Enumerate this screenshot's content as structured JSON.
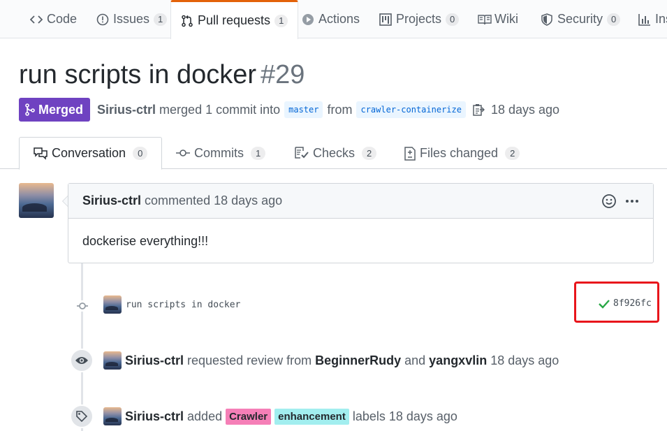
{
  "repo_nav": {
    "tabs": [
      {
        "label": "Code",
        "count": "",
        "icon": "code-icon"
      },
      {
        "label": "Issues",
        "count": "1",
        "icon": "issue-icon"
      },
      {
        "label": "Pull requests",
        "count": "1",
        "icon": "pull-request-icon",
        "selected": true
      },
      {
        "label": "Actions",
        "count": "",
        "icon": "play-icon"
      },
      {
        "label": "Projects",
        "count": "0",
        "icon": "project-icon"
      },
      {
        "label": "Wiki",
        "count": "",
        "icon": "book-icon"
      },
      {
        "label": "Security",
        "count": "0",
        "icon": "shield-icon"
      },
      {
        "label": "Ins",
        "count": "",
        "icon": "graph-icon"
      }
    ]
  },
  "pr": {
    "title": "run scripts in docker",
    "number": "#29",
    "state": "Merged",
    "author": "Sirius-ctrl",
    "action_text": "merged 1 commit into",
    "base_branch": "master",
    "from_text": "from",
    "head_branch": "crawler-containerize",
    "time": "18 days ago"
  },
  "pr_tabs": [
    {
      "label": "Conversation",
      "count": "0",
      "icon": "comment-icon"
    },
    {
      "label": "Commits",
      "count": "1",
      "icon": "commit-icon"
    },
    {
      "label": "Checks",
      "count": "2",
      "icon": "checklist-icon"
    },
    {
      "label": "Files changed",
      "count": "2",
      "icon": "file-diff-icon"
    }
  ],
  "comment": {
    "author": "Sirius-ctrl",
    "meta": "commented 18 days ago",
    "body": "dockerise everything!!!"
  },
  "commit": {
    "message": "run scripts in docker",
    "sha": "8f926fc",
    "status_color": "#28a745"
  },
  "review_event": {
    "actor": "Sirius-ctrl",
    "text": "requested review from",
    "reviewer1": "BeginnerRudy",
    "and_text": "and",
    "reviewer2": "yangxvlin",
    "time": "18 days ago"
  },
  "label_event": {
    "actor": "Sirius-ctrl",
    "text": "added",
    "labels": [
      {
        "name": "Crawler",
        "color": "#f57fb7"
      },
      {
        "name": "enhancement",
        "color": "#a2eeef"
      }
    ],
    "suffix": "labels 18 days ago"
  },
  "colors": {
    "merged": "#6f42c1",
    "highlight": "#e8151b",
    "nav_accent": "#e36209"
  }
}
